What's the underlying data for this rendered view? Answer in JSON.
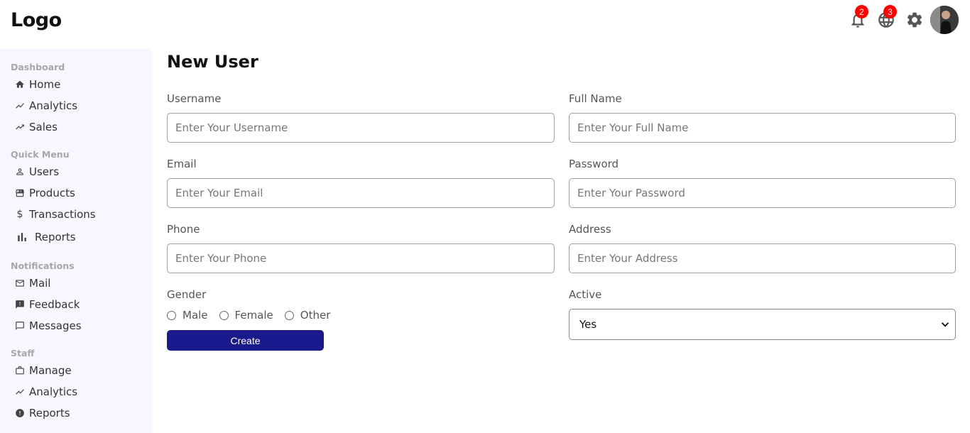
{
  "header": {
    "logo": "Logo",
    "notifications_count": "2",
    "language_count": "3",
    "icons": [
      "bell-icon",
      "globe-icon",
      "gear-icon",
      "avatar"
    ]
  },
  "sidebar": {
    "sections": [
      {
        "title": "Dashboard",
        "items": [
          {
            "label": "Home",
            "icon": "home-icon"
          },
          {
            "label": "Analytics",
            "icon": "trending-icon"
          },
          {
            "label": "Sales",
            "icon": "trending-up-icon"
          }
        ]
      },
      {
        "title": "Quick Menu",
        "items": [
          {
            "label": "Users",
            "icon": "user-icon"
          },
          {
            "label": "Products",
            "icon": "store-icon"
          },
          {
            "label": "Transactions",
            "icon": "dollar-icon"
          },
          {
            "label": "Reports",
            "icon": "bar-chart-icon"
          }
        ]
      },
      {
        "title": "Notifications",
        "items": [
          {
            "label": "Mail",
            "icon": "mail-icon"
          },
          {
            "label": "Feedback",
            "icon": "feedback-icon"
          },
          {
            "label": "Messages",
            "icon": "chat-icon"
          }
        ]
      },
      {
        "title": "Staff",
        "items": [
          {
            "label": "Manage",
            "icon": "briefcase-icon"
          },
          {
            "label": "Analytics",
            "icon": "trending-icon"
          },
          {
            "label": "Reports",
            "icon": "alert-icon"
          }
        ]
      }
    ]
  },
  "form": {
    "title": "New User",
    "username": {
      "label": "Username",
      "placeholder": "Enter Your Username"
    },
    "full_name": {
      "label": "Full Name",
      "placeholder": "Enter Your Full Name"
    },
    "email": {
      "label": "Email",
      "placeholder": "Enter Your Email"
    },
    "password": {
      "label": "Password",
      "placeholder": "Enter Your Password"
    },
    "phone": {
      "label": "Phone",
      "placeholder": "Enter Your Phone"
    },
    "address": {
      "label": "Address",
      "placeholder": "Enter Your Address"
    },
    "gender": {
      "label": "Gender",
      "options": [
        "Male",
        "Female",
        "Other"
      ]
    },
    "active": {
      "label": "Active",
      "value": "Yes"
    },
    "create_label": "Create"
  },
  "colors": {
    "primary_button": "#1a1a8c",
    "badge": "#ff0000",
    "sidebar_bg": "#f7f7ff"
  }
}
